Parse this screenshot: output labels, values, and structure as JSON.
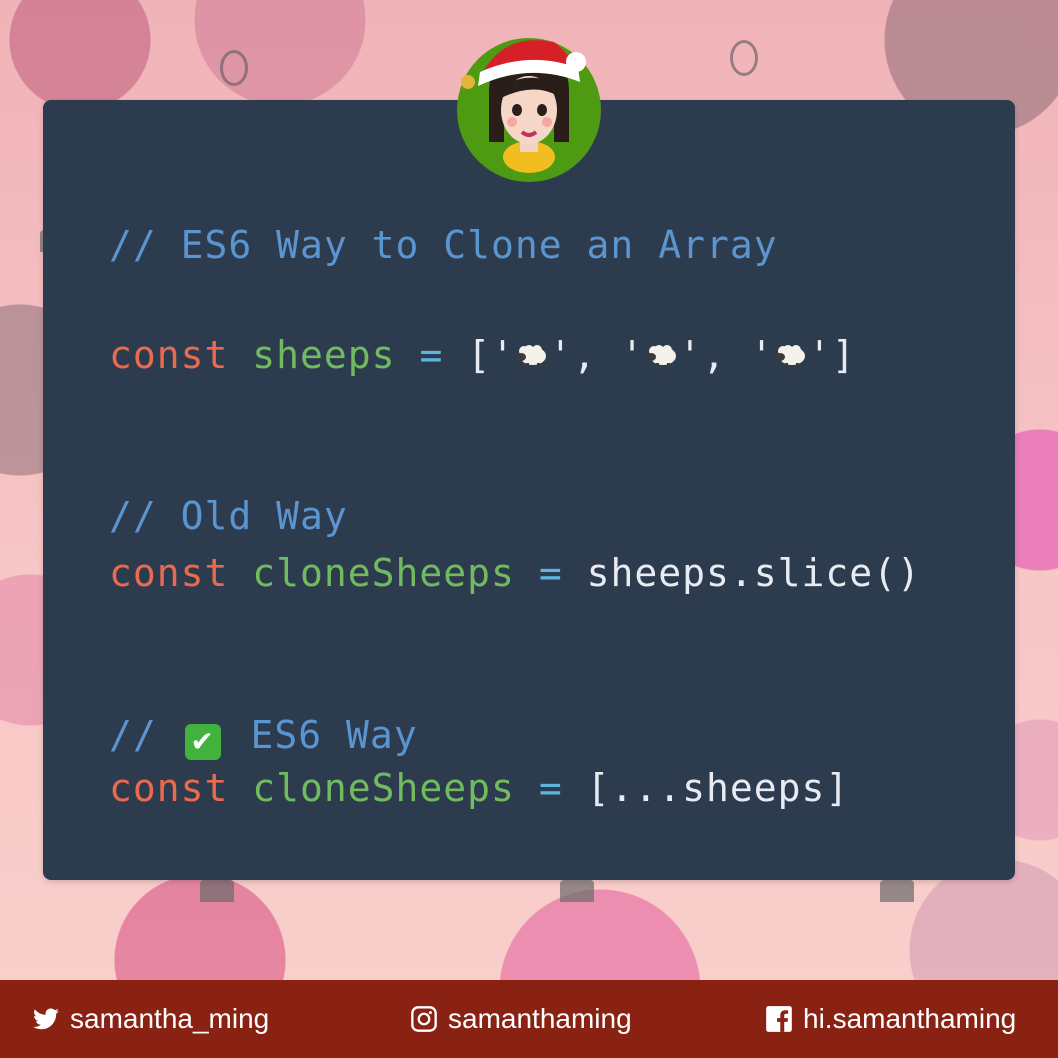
{
  "code": {
    "comment_title": "// ES6 Way to Clone an Array",
    "line_sheeps": {
      "keyword": "const",
      "name": "sheeps",
      "op": "=",
      "open": "['",
      "sep1": "', '",
      "sep2": "', '",
      "close": "']"
    },
    "comment_old": "// Old Way",
    "line_old": {
      "keyword": "const",
      "name": "cloneSheeps",
      "op": "=",
      "value": "sheeps.slice()"
    },
    "comment_es6_prefix": "//",
    "comment_es6_suffix": "ES6 Way",
    "check_glyph": "✔",
    "line_es6": {
      "keyword": "const",
      "name": "cloneSheeps",
      "op": "=",
      "value": "[...sheeps]"
    }
  },
  "footer": {
    "twitter": "samantha_ming",
    "instagram": "samanthaming",
    "facebook": "hi.samanthaming"
  },
  "icons": {
    "twitter": "twitter-icon",
    "instagram": "instagram-icon",
    "facebook": "facebook-icon",
    "sheep": "sheep-emoji",
    "check": "check-mark-emoji",
    "avatar": "avatar-santa-hat"
  },
  "colors": {
    "panel": "#2d3b4f",
    "comment": "#5a95d0",
    "keyword": "#ea6a4d",
    "variable": "#71bb5f",
    "operator": "#5fb5e0",
    "footer": "#8a2214"
  }
}
